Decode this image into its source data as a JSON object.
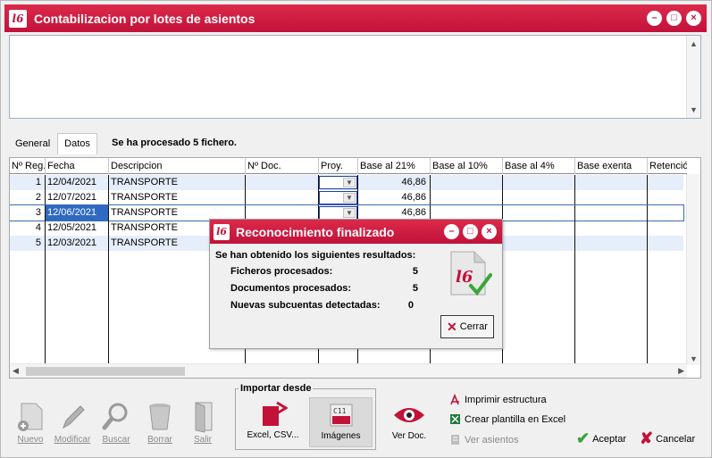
{
  "window": {
    "title": "Contabilizacion por lotes de asientos",
    "logo_text": "l6"
  },
  "window_controls": {
    "minimize": "–",
    "maximize": "□",
    "close": "×"
  },
  "tabs": [
    {
      "label": "General"
    },
    {
      "label": "Datos"
    }
  ],
  "status_message": "Se ha procesado 5 fichero.",
  "grid": {
    "columns": [
      "Nº Reg.",
      "Fecha",
      "Descripcion",
      "Nº Doc.",
      "Proy.",
      "Base al  21%",
      "Base al 10%",
      "Base al 4%",
      "Base exenta",
      "Retenció"
    ],
    "rows": [
      {
        "reg": "1",
        "fecha": "12/04/2021",
        "descripcion": "TRANSPORTE",
        "base21": "46,86"
      },
      {
        "reg": "2",
        "fecha": "12/07/2021",
        "descripcion": "TRANSPORTE",
        "base21": "46,86"
      },
      {
        "reg": "3",
        "fecha": "12/06/2021",
        "descripcion": "TRANSPORTE",
        "base21": "46,86"
      },
      {
        "reg": "4",
        "fecha": "12/05/2021",
        "descripcion": "TRANSPORTE",
        "base21": ""
      },
      {
        "reg": "5",
        "fecha": "12/03/2021",
        "descripcion": "TRANSPORTE",
        "base21": ""
      }
    ]
  },
  "dialog": {
    "title": "Reconocimiento finalizado",
    "heading": "Se han obtenido los siguientes resultados:",
    "results": [
      {
        "label": "Ficheros procesados:",
        "value": "5"
      },
      {
        "label": "Documentos procesados:",
        "value": "5"
      },
      {
        "label": "Nuevas subcuentas detectadas:",
        "value": "0"
      }
    ],
    "close_label": "Cerrar"
  },
  "toolbar": {
    "nuevo": "Nuevo",
    "modificar": "Modificar",
    "buscar": "Buscar",
    "borrar": "Borrar",
    "salir": "Salir"
  },
  "import_group": {
    "title": "Importar desde",
    "excel_label": "Excel, CSV...",
    "imagenes_label": "Imágenes"
  },
  "ver_doc_label": "Ver Doc.",
  "links": {
    "imprimir": "Imprimir estructura",
    "plantilla": "Crear plantilla en Excel",
    "ver_asientos": "Ver asientos"
  },
  "actions": {
    "aceptar": "Aceptar",
    "cancelar": "Cancelar"
  },
  "colors": {
    "accent": "#c2123a",
    "selection": "#2f69c2",
    "row_alt": "#e6eefb",
    "ok_green": "#3aa53a"
  }
}
